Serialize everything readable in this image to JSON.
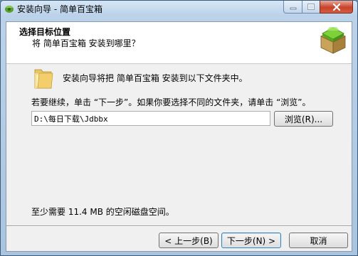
{
  "window": {
    "title": "安装向导 - 简单百宝箱"
  },
  "header": {
    "title": "选择目标位置",
    "subtitle": "将 简单百宝箱 安装到哪里？"
  },
  "main": {
    "intro": "安装向导将把 简单百宝箱 安装到以下文件夹中。",
    "instruction": "若要继续，单击 “下一步”。如果你要选择不同的文件夹，请单击 “浏览”。",
    "path_value": "D:\\每日下载\\Jdbbx",
    "browse_label": "浏览(R)...",
    "space_required": "至少需要 11.4 MB 的空闲磁盘空间。"
  },
  "footer": {
    "back_label": "< 上一步(B)",
    "next_label": "下一步(N) >",
    "cancel_label": "取消"
  },
  "colors": {
    "accent": "#3c7fb1",
    "close": "#c7432c"
  }
}
